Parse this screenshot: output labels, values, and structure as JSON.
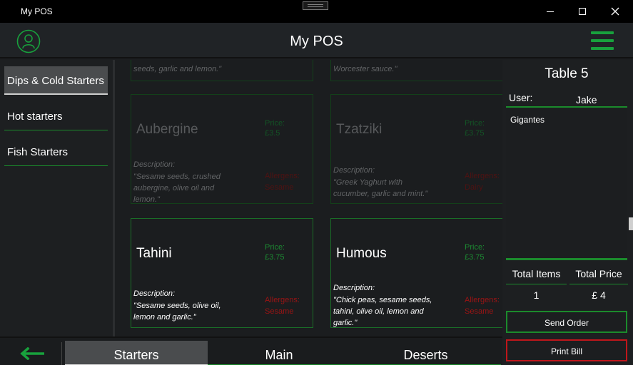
{
  "window": {
    "title": "My POS"
  },
  "header": {
    "title": "My POS"
  },
  "sidebar": {
    "items": [
      {
        "label": "Dips & Cold Starters",
        "active": true
      },
      {
        "label": "Hot starters",
        "active": false
      },
      {
        "label": "Fish Starters",
        "active": false
      }
    ]
  },
  "grid": {
    "partial_top": [
      {
        "text": "seeds, garlic and lemon.\""
      },
      {
        "text": "Worcester sauce.\""
      }
    ],
    "cards": [
      {
        "name": "Aubergine",
        "price_label": "Price:",
        "price": "£3.5",
        "desc_label": "Description:",
        "desc": "\"Sesame seeds, crushed aubergine, olive oil and lemon.\"",
        "allergens_label": "Allergens:",
        "allergens": "Sesame"
      },
      {
        "name": "Tzatziki",
        "price_label": "Price:",
        "price": "£3.75",
        "desc_label": "Description:",
        "desc": "\"Greek Yaghurt with cucumber, garlic and mint.\"",
        "allergens_label": "Allergens:",
        "allergens": "Dairy"
      },
      {
        "name": "Tahini",
        "price_label": "Price:",
        "price": "£3.75",
        "desc_label": "Description:",
        "desc": "\"Sesame seeds, olive oil, lemon and garlic.\"",
        "allergens_label": "Allergens:",
        "allergens": "Sesame"
      },
      {
        "name": "Humous",
        "price_label": "Price:",
        "price": "£3.75",
        "desc_label": "Description:",
        "desc": "\"Chick peas, sesame seeds, tahini, olive oil, lemon and garlic.\"",
        "allergens_label": "Allergens:",
        "allergens": "Sesame"
      }
    ]
  },
  "order": {
    "table_title": "Table 5",
    "user_label": "User:",
    "user": "Jake",
    "items": [
      "Gigantes"
    ],
    "total_items_label": "Total Items",
    "total_price_label": "Total Price",
    "total_items": "1",
    "total_price": "£ 4",
    "send_label": "Send Order",
    "print_label": "Print Bill"
  },
  "bottom_nav": {
    "tabs": [
      {
        "label": "Starters",
        "active": true
      },
      {
        "label": "Main",
        "active": false
      },
      {
        "label": "Deserts",
        "active": false
      }
    ]
  },
  "colors": {
    "accent": "#1b8b2c",
    "danger": "#c0161b",
    "background": "#1c1e20"
  },
  "icons": [
    "user-icon",
    "hamburger-menu-icon",
    "back-arrow-icon",
    "minimize-icon",
    "maximize-icon",
    "close-icon"
  ]
}
